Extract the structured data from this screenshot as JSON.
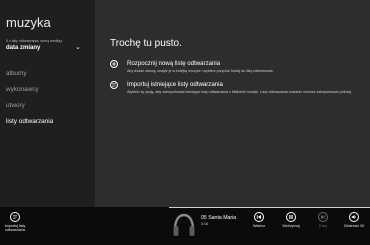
{
  "app": {
    "title": "muzyka"
  },
  "sort": {
    "caption": "0 z listy odtwarzania, sortuj według:",
    "value": "data zmiany"
  },
  "nav": [
    {
      "label": "albumy",
      "active": false
    },
    {
      "label": "wykonawcy",
      "active": false
    },
    {
      "label": "utwory",
      "active": false
    },
    {
      "label": "listy odtwarzania",
      "active": true
    }
  ],
  "main": {
    "empty_title": "Trochę tu pusto.",
    "actions": [
      {
        "title": "Rozpocznij nową listę odtwarzania",
        "desc": "Aby dodać utwory, znajdź je w kolejkę muzyce i wybierz przycisk Dodaj do listy odtwarzania.",
        "icon": "plus-icon"
      },
      {
        "title": "Importuj istniejące listy odtwarzania",
        "desc": "Wybierz tę opcję, aby zaimportować istniejące listy odtwarzania z biblioteki muzyki. Listy odtwarzania zostanie możesz zaimportować później.",
        "icon": "import-icon"
      }
    ]
  },
  "appbar": {
    "import_label": "Importuj listy odtwarzania",
    "now_playing": {
      "title": "05 Santa Maria",
      "time": "3:16",
      "progress": 0.0
    },
    "buttons": [
      {
        "label": "Wstecz",
        "icon": "previous-icon",
        "disabled": false
      },
      {
        "label": "Wstrzymaj",
        "icon": "pause-icon",
        "disabled": false
      },
      {
        "label": "Dalej",
        "icon": "next-icon",
        "disabled": true
      },
      {
        "label": "Głośność 30",
        "icon": "volume-icon",
        "disabled": false
      }
    ]
  }
}
